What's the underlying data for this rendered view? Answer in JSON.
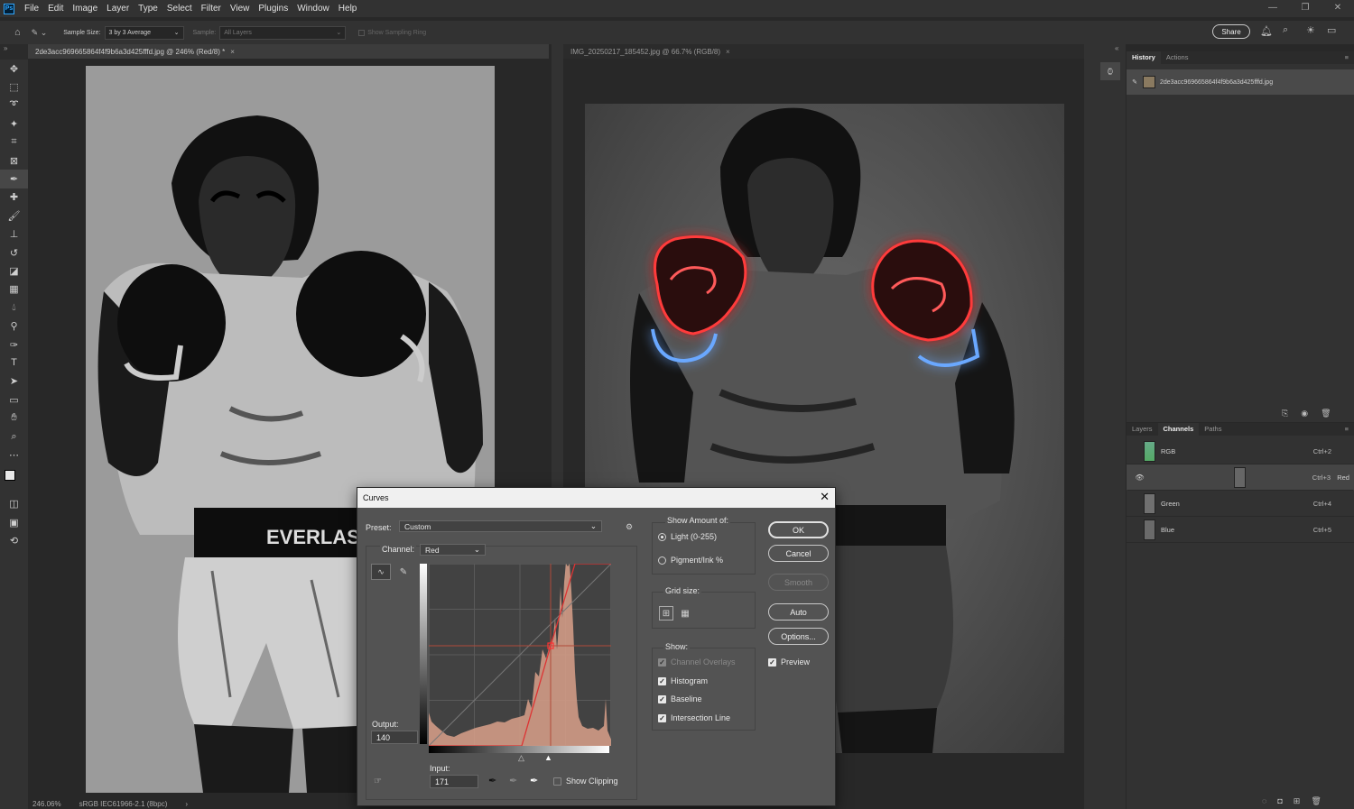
{
  "app": {
    "logo": "Ps"
  },
  "menu": [
    "File",
    "Edit",
    "Image",
    "Layer",
    "Type",
    "Select",
    "Filter",
    "View",
    "Plugins",
    "Window",
    "Help"
  ],
  "window_controls": [
    "—",
    "❐",
    "✕"
  ],
  "options": {
    "sample_size_label": "Sample Size:",
    "sample_size_value": "3 by 3 Average",
    "sample_label": "Sample:",
    "sample_value": "All Layers",
    "sampling_ring": "Show Sampling Ring",
    "share": "Share"
  },
  "tabs": [
    {
      "label": "2de3acc969665864f4f9b6a3d425fffd.jpg @ 246% (Red/8) *",
      "close": "×"
    },
    {
      "label": "IMG_20250217_185452.jpg @ 66.7% (RGB/8)",
      "close": "×"
    }
  ],
  "tools": [
    "move-tool",
    "marquee-tool",
    "lasso-tool",
    "magic-wand-tool",
    "crop-tool",
    "frame-tool",
    "eyedropper-tool",
    "healing-brush-tool",
    "brush-tool",
    "clone-stamp-tool",
    "history-brush-tool",
    "eraser-tool",
    "gradient-tool",
    "blur-tool",
    "dodge-tool",
    "pen-tool",
    "type-tool",
    "path-selection-tool",
    "rectangle-tool",
    "hand-tool",
    "zoom-tool",
    "more-tools"
  ],
  "history": {
    "tabs": [
      "History",
      "Actions"
    ],
    "items": [
      {
        "label": "2de3acc969665864f4f9b6a3d425fffd.jpg"
      }
    ]
  },
  "channels": {
    "tabs": [
      "Layers",
      "Channels",
      "Paths"
    ],
    "rows": [
      {
        "name": "RGB",
        "shortcut": "Ctrl+2",
        "visible": false,
        "selected": false
      },
      {
        "name": "Red",
        "shortcut": "Ctrl+3",
        "visible": true,
        "selected": true
      },
      {
        "name": "Green",
        "shortcut": "Ctrl+4",
        "visible": false,
        "selected": false
      },
      {
        "name": "Blue",
        "shortcut": "Ctrl+5",
        "visible": false,
        "selected": false
      }
    ]
  },
  "status": {
    "zoom": "246.06%",
    "profile": "sRGB IEC61966-2.1 (8bpc)"
  },
  "curves": {
    "title": "Curves",
    "preset_label": "Preset:",
    "preset_value": "Custom",
    "channel_label": "Channel:",
    "channel_value": "Red",
    "output_label": "Output:",
    "output_value": "140",
    "input_label": "Input:",
    "input_value": "171",
    "show_clipping": "Show Clipping",
    "show_amount_label": "Show Amount of:",
    "light_label": "Light  (0-255)",
    "pigment_label": "Pigment/Ink %",
    "grid_size_label": "Grid size:",
    "show_label": "Show:",
    "show_options": [
      {
        "label": "Channel Overlays",
        "checked": true,
        "disabled": true
      },
      {
        "label": "Histogram",
        "checked": true,
        "disabled": false
      },
      {
        "label": "Baseline",
        "checked": true,
        "disabled": false
      },
      {
        "label": "Intersection Line",
        "checked": true,
        "disabled": false
      }
    ],
    "buttons": {
      "ok": "OK",
      "cancel": "Cancel",
      "smooth": "Smooth",
      "auto": "Auto",
      "options": "Options..."
    },
    "preview_label": "Preview",
    "accent": "#d9a08a"
  }
}
